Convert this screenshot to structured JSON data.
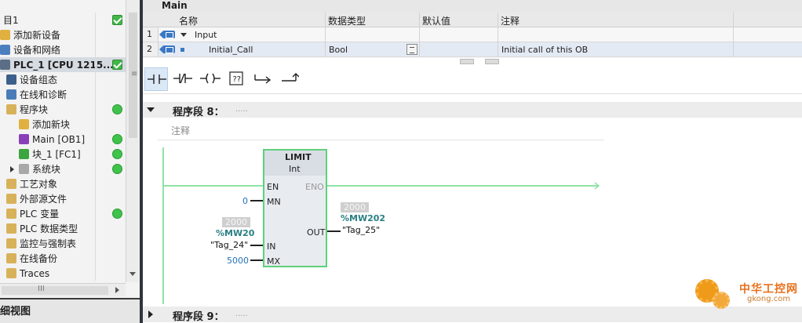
{
  "project_tree": {
    "items": [
      {
        "label": "目1",
        "icon": "project-icon",
        "status": "check",
        "level": 0,
        "bold": false,
        "selected": false
      },
      {
        "label": "添加新设备",
        "icon": "add-device-icon",
        "status": "",
        "level": 0
      },
      {
        "label": "设备和网络",
        "icon": "network-icon",
        "status": "",
        "level": 0
      },
      {
        "label": "PLC_1 [CPU 1215...",
        "icon": "plc-icon",
        "status": "check",
        "level": 0,
        "bold": true,
        "selected": true
      },
      {
        "label": "设备组态",
        "icon": "device-config-icon",
        "status": "",
        "level": 1
      },
      {
        "label": "在线和诊断",
        "icon": "online-diagnostics-icon",
        "status": "",
        "level": 1
      },
      {
        "label": "程序块",
        "icon": "program-blocks-folder-icon",
        "status": "ok",
        "level": 1
      },
      {
        "label": "添加新块",
        "icon": "add-block-icon",
        "status": "",
        "level": 2
      },
      {
        "label": "Main [OB1]",
        "icon": "ob-block-icon",
        "status": "ok",
        "level": 2
      },
      {
        "label": "块_1 [FC1]",
        "icon": "fc-block-icon",
        "status": "ok",
        "level": 2
      },
      {
        "label": "系统块",
        "icon": "system-blocks-folder-icon",
        "status": "ok",
        "level": 2,
        "arrow": true
      },
      {
        "label": "工艺对象",
        "icon": "technology-objects-folder-icon",
        "status": "",
        "level": 1
      },
      {
        "label": "外部源文件",
        "icon": "external-sources-folder-icon",
        "status": "",
        "level": 1
      },
      {
        "label": "PLC 变量",
        "icon": "plc-tags-folder-icon",
        "status": "ok",
        "level": 1
      },
      {
        "label": "PLC 数据类型",
        "icon": "plc-datatypes-folder-icon",
        "status": "",
        "level": 1
      },
      {
        "label": "监控与强制表",
        "icon": "watch-tables-folder-icon",
        "status": "",
        "level": 1
      },
      {
        "label": "在线备份",
        "icon": "online-backups-folder-icon",
        "status": "",
        "level": 1
      },
      {
        "label": "Traces",
        "icon": "traces-folder-icon",
        "status": "",
        "level": 1
      }
    ],
    "detail_view_label": "细视图",
    "colors": {
      "status_ok": "#3fc34a"
    }
  },
  "editor": {
    "block_title": "Main",
    "interface": {
      "headers": {
        "name": "名称",
        "datatype": "数据类型",
        "default": "默认值",
        "comment": "注释"
      },
      "rows": [
        {
          "num": "1",
          "name": "Input",
          "datatype": "",
          "default": "",
          "comment": ""
        },
        {
          "num": "2",
          "name": "Initial_Call",
          "datatype": "Bool",
          "default": "",
          "comment": "Initial call of this OB"
        }
      ]
    },
    "toolbar": {
      "buttons": [
        "no-contact-icon",
        "nc-contact-icon",
        "coil-icon",
        "empty-box-icon",
        "open-branch-icon",
        "close-branch-icon"
      ]
    },
    "networks": [
      {
        "title": "程序段 8：",
        "dots": ".....",
        "comment_placeholder": "注释",
        "expanded": true
      },
      {
        "title": "程序段 9：",
        "dots": ".....",
        "expanded": false
      }
    ],
    "limit_box": {
      "name": "LIMIT",
      "type": "Int",
      "inputs": {
        "en": "EN",
        "mn": "MN",
        "in": "IN",
        "mx": "MX"
      },
      "outputs": {
        "eno": "ENO",
        "out": "OUT"
      },
      "mn_value": "0",
      "mx_value": "5000",
      "in_monitor": "2000",
      "in_address": "%MW20",
      "in_tag": "\"Tag_24\"",
      "out_monitor": "2000",
      "out_address": "%MW202",
      "out_tag": "\"Tag_25\""
    },
    "colors": {
      "powerflow": "#8fe3a5",
      "box_fill": "#e8ecf0",
      "box_border": "#5fcf7c"
    }
  },
  "watermark": {
    "cn": "中华工控网",
    "en": "gkong.com"
  }
}
